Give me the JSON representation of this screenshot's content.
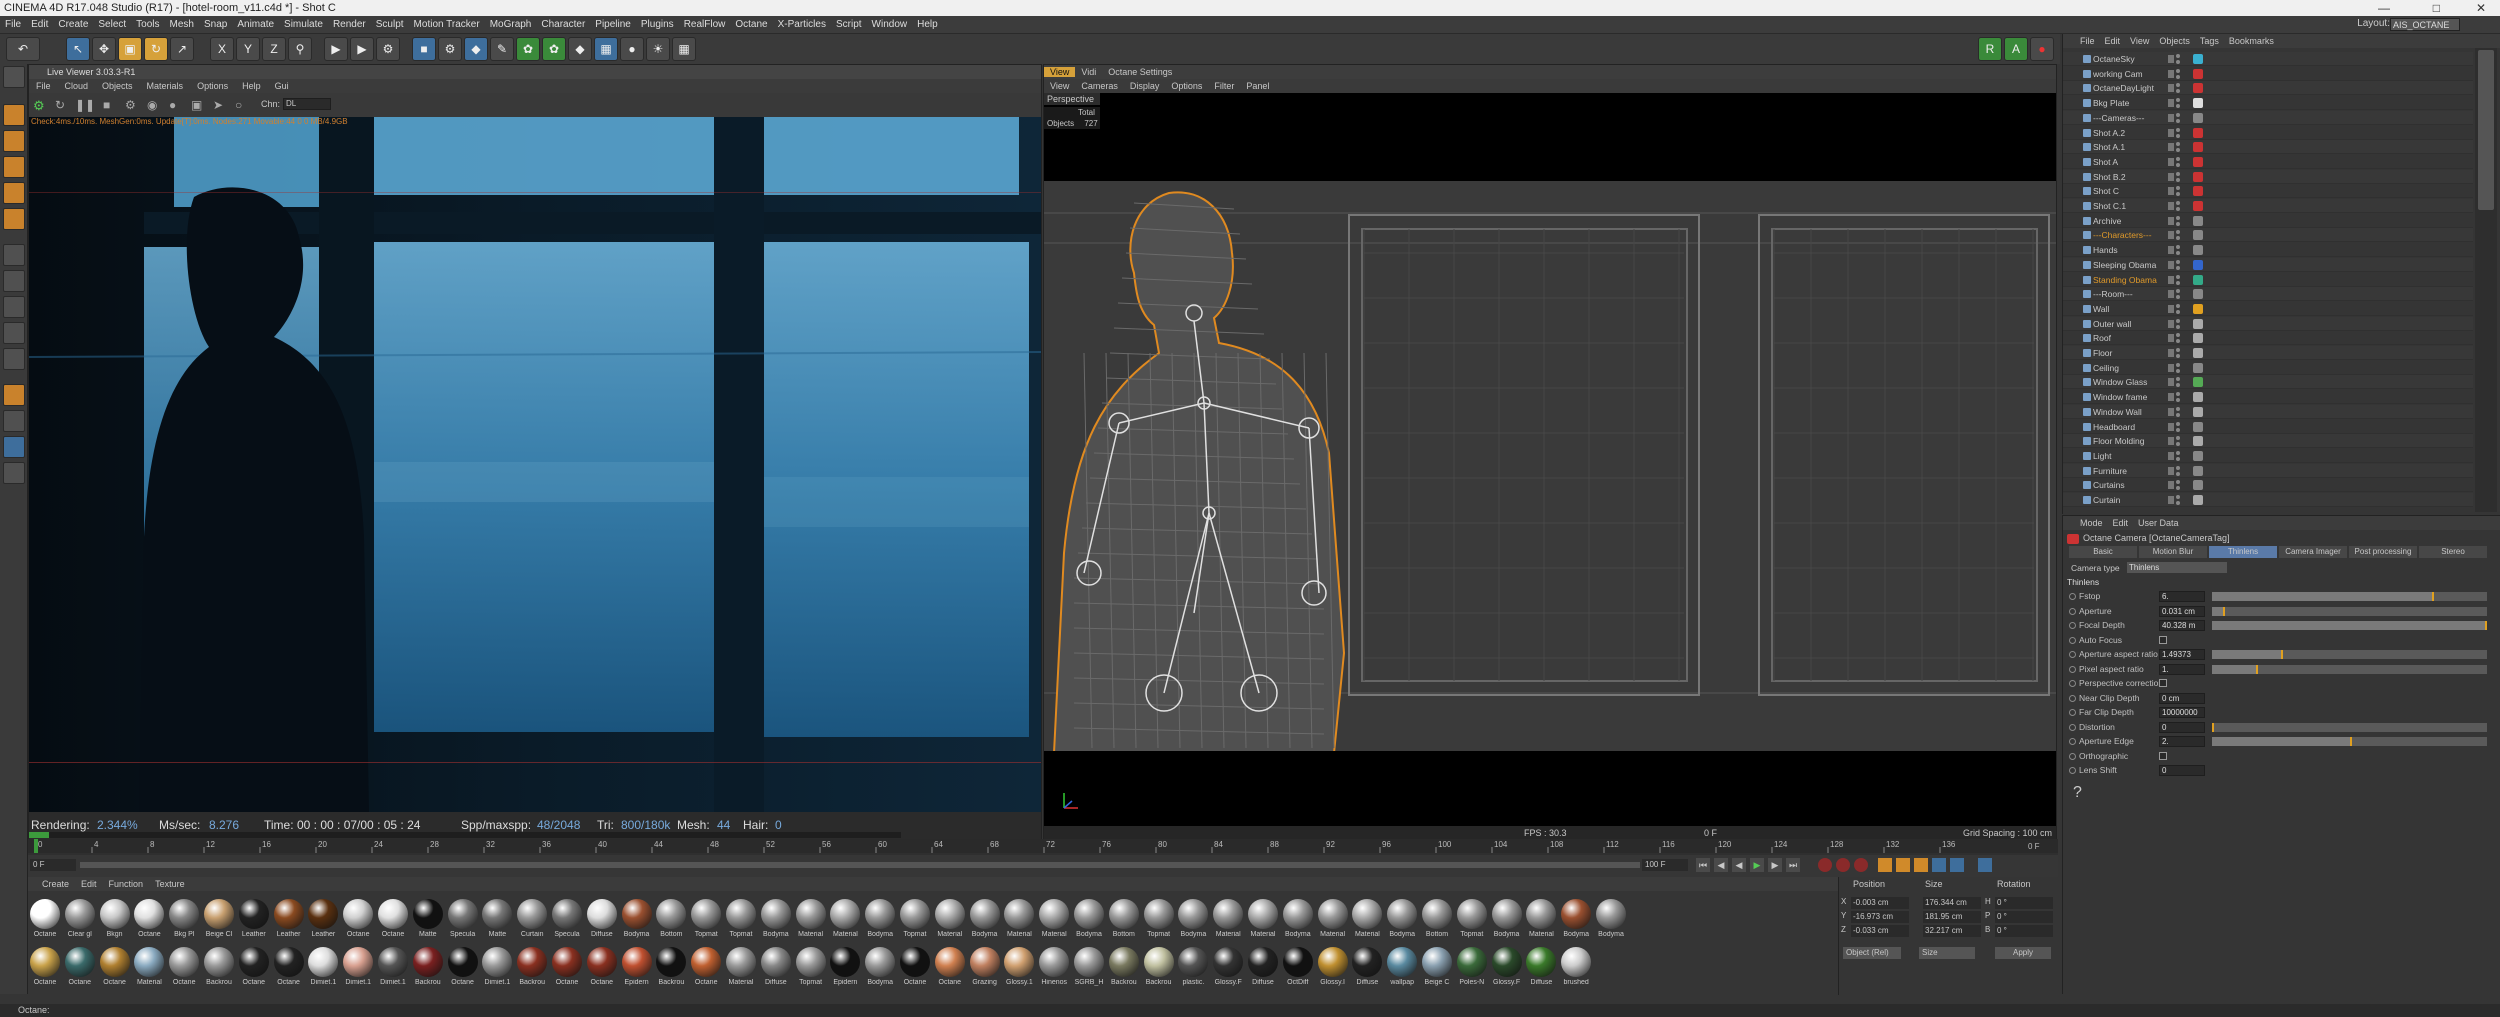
{
  "window": {
    "title": "CINEMA 4D R17.048 Studio (R17) - [hotel-room_v11.c4d *] - Shot C"
  },
  "menu": [
    "File",
    "Edit",
    "Create",
    "Select",
    "Tools",
    "Mesh",
    "Snap",
    "Animate",
    "Simulate",
    "Render",
    "Sculpt",
    "Motion Tracker",
    "MoGraph",
    "Character",
    "Pipeline",
    "Plugins",
    "RealFlow",
    "Octane",
    "X-Particles",
    "Script",
    "Window",
    "Help"
  ],
  "layout": {
    "label": "Layout:",
    "value": "AIS_OCTANE (User)"
  },
  "live_viewer": {
    "title": "Live Viewer 3.03.3-R1",
    "menu": [
      "File",
      "Cloud",
      "Objects",
      "Materials",
      "Options",
      "Help",
      "Gui"
    ],
    "chn_label": "Chn:",
    "chn_value": "DL",
    "status_line": "Check:4ms./10ms. MeshGen:0ms. Update[T]:0ms. Nodes:271 Movable:44   0 0 MB/4.9GB",
    "rendering_label": "Rendering:",
    "rendering_value": "2.344%",
    "mssec_label": "Ms/sec:",
    "mssec_value": "8.276",
    "time_label": "Time:",
    "time_value": "00 : 00 : 07/00 : 05 : 24",
    "spp_label": "Spp/maxspp:",
    "spp_value": "48/2048",
    "tri_label": "Tri:",
    "tri_value": "800/180k",
    "mesh_label": "Mesh:",
    "mesh_value": "44",
    "hair_label": "Hair:",
    "hair_value": "0"
  },
  "viewport": {
    "tabs": [
      "View",
      "Vidi",
      "Octane Settings"
    ],
    "menu": [
      "View",
      "Cameras",
      "Display",
      "Options",
      "Filter",
      "Panel"
    ],
    "camera_label": "Perspective",
    "stats_header": "Total",
    "stats_row_label": "Objects",
    "stats_row_value": "727",
    "fps": "FPS : 30.3",
    "frame": "0 F",
    "grid_spacing": "Grid Spacing : 100 cm"
  },
  "timeline": {
    "ticks": [
      "0",
      "4",
      "8",
      "12",
      "16",
      "20",
      "24",
      "28",
      "32",
      "36",
      "40",
      "44",
      "48",
      "52",
      "56",
      "60",
      "64",
      "68",
      "72",
      "76",
      "80",
      "84",
      "88",
      "92",
      "96",
      "100",
      "104",
      "108",
      "112",
      "116",
      "120",
      "124",
      "128",
      "132",
      "136"
    ],
    "end_label": "0 F",
    "start_field": "0 F",
    "min_field": "0 F",
    "max_field": "100 F",
    "end_field": "100 F"
  },
  "objects": {
    "menu": [
      "File",
      "Edit",
      "View",
      "Objects",
      "Tags",
      "Bookmarks"
    ],
    "rows": [
      {
        "name": "OctaneSky",
        "style": "n"
      },
      {
        "name": "working Cam",
        "style": "n"
      },
      {
        "name": "OctaneDayLight",
        "style": "n"
      },
      {
        "name": "Bkg Plate",
        "style": "n"
      },
      {
        "name": "---Cameras---",
        "style": "n"
      },
      {
        "name": "Shot A.2",
        "style": "n"
      },
      {
        "name": "Shot A.1",
        "style": "n"
      },
      {
        "name": "Shot A",
        "style": "n"
      },
      {
        "name": "Shot B.2",
        "style": "n"
      },
      {
        "name": "Shot C",
        "style": "n"
      },
      {
        "name": "Shot C.1",
        "style": "n"
      },
      {
        "name": "Archive",
        "style": "n"
      },
      {
        "name": "---Characters---",
        "style": "o"
      },
      {
        "name": "Hands",
        "style": "n"
      },
      {
        "name": "Sleeping Obama",
        "style": "n"
      },
      {
        "name": "Standing Obama",
        "style": "o"
      },
      {
        "name": "---Room---",
        "style": "n"
      },
      {
        "name": "Wall",
        "style": "n"
      },
      {
        "name": "Outer wall",
        "style": "n"
      },
      {
        "name": "Roof",
        "style": "n"
      },
      {
        "name": "Floor",
        "style": "n"
      },
      {
        "name": "Ceiling",
        "style": "n"
      },
      {
        "name": "Window Glass",
        "style": "n"
      },
      {
        "name": "Window frame",
        "style": "n"
      },
      {
        "name": "Window Wall",
        "style": "n"
      },
      {
        "name": "Headboard",
        "style": "n"
      },
      {
        "name": "Floor Molding",
        "style": "n"
      },
      {
        "name": "Light",
        "style": "n"
      },
      {
        "name": "Furniture",
        "style": "n"
      },
      {
        "name": "Curtains",
        "style": "n"
      },
      {
        "name": "Curtain",
        "style": "n"
      }
    ]
  },
  "attributes": {
    "menu": [
      "Mode",
      "Edit",
      "User Data"
    ],
    "object_title": "Octane Camera [OctaneCameraTag]",
    "tabs": [
      "Basic",
      "Motion Blur",
      "Thinlens",
      "Camera Imager",
      "Post processing",
      "Stereo"
    ],
    "active_tab": "Thinlens",
    "camera_type_label": "Camera type",
    "camera_type_value": "Thinlens",
    "section": "Thinlens",
    "fields": [
      {
        "label": "Fstop",
        "value": "6.",
        "fill": 0.8
      },
      {
        "label": "Aperture",
        "value": "0.031 cm",
        "fill": 0.04
      },
      {
        "label": "Focal Depth",
        "value": "40.328 m",
        "fill": 1.0
      },
      {
        "label": "Auto Focus",
        "value": "",
        "fill": -1
      },
      {
        "label": "Aperture aspect ratio",
        "value": "1.49373",
        "fill": 0.25
      },
      {
        "label": "Pixel aspect ratio",
        "value": "1.",
        "fill": 0.16
      },
      {
        "label": "Perspective correction",
        "value": "",
        "fill": -1
      },
      {
        "label": "Near Clip Depth",
        "value": "0 cm",
        "fill": -1
      },
      {
        "label": "Far Clip Depth",
        "value": "10000000",
        "fill": -1
      },
      {
        "label": "Distortion",
        "value": "0",
        "fill": 0.0
      },
      {
        "label": "Aperture Edge",
        "value": "2.",
        "fill": 0.5
      },
      {
        "label": "Orthographic",
        "value": "",
        "fill": -1
      },
      {
        "label": "Lens Shift",
        "value": "0",
        "fill": -1
      }
    ]
  },
  "materials": {
    "menu": [
      "Create",
      "Edit",
      "Function",
      "Texture"
    ],
    "row1": [
      {
        "label": "Octane",
        "color": "#ffffff"
      },
      {
        "label": "Clear gl",
        "color": "#9a9a9a"
      },
      {
        "label": "Bkgn",
        "color": "#c8c8c8"
      },
      {
        "label": "Octane",
        "color": "#e0e0e0"
      },
      {
        "label": "Bkg Pl",
        "color": "#888"
      },
      {
        "label": "Beige Cl",
        "color": "#c8a070"
      },
      {
        "label": "Leather",
        "color": "#222"
      },
      {
        "label": "Leather",
        "color": "#8a4a20"
      },
      {
        "label": "Leather",
        "color": "#5a3010"
      },
      {
        "label": "Octane",
        "color": "#d0d0d0"
      },
      {
        "label": "Octane",
        "color": "#e0e0e0"
      },
      {
        "label": "Matte",
        "color": "#111"
      },
      {
        "label": "Specula",
        "color": "#777"
      },
      {
        "label": "Matte",
        "color": "#777"
      },
      {
        "label": "Curtain",
        "color": "#999"
      },
      {
        "label": "Specula",
        "color": "#777"
      },
      {
        "label": "Diffuse",
        "color": "#ddd"
      },
      {
        "label": "Bodyma",
        "color": "#9a5030"
      },
      {
        "label": "Bottom",
        "color": "#999"
      },
      {
        "label": "Topmat",
        "color": "#999"
      },
      {
        "label": "Topmat",
        "color": "#999"
      },
      {
        "label": "Bodyma",
        "color": "#999"
      },
      {
        "label": "Material",
        "color": "#999"
      },
      {
        "label": "Material",
        "color": "#aaa"
      },
      {
        "label": "Bodyma",
        "color": "#999"
      },
      {
        "label": "Topmat",
        "color": "#999"
      },
      {
        "label": "Material",
        "color": "#aaa"
      },
      {
        "label": "Bodyma",
        "color": "#999"
      },
      {
        "label": "Material",
        "color": "#999"
      },
      {
        "label": "Material",
        "color": "#aaa"
      },
      {
        "label": "Bodyma",
        "color": "#999"
      },
      {
        "label": "Bottom",
        "color": "#999"
      },
      {
        "label": "Topmat",
        "color": "#999"
      },
      {
        "label": "Bodyma",
        "color": "#999"
      },
      {
        "label": "Material",
        "color": "#999"
      },
      {
        "label": "Material",
        "color": "#aaa"
      },
      {
        "label": "Bodyma",
        "color": "#999"
      },
      {
        "label": "Material",
        "color": "#999"
      },
      {
        "label": "Material",
        "color": "#aaa"
      },
      {
        "label": "Bodyma",
        "color": "#999"
      },
      {
        "label": "Bottom",
        "color": "#999"
      },
      {
        "label": "Topmat",
        "color": "#999"
      },
      {
        "label": "Bodyma",
        "color": "#999"
      },
      {
        "label": "Material",
        "color": "#999"
      },
      {
        "label": "Bodyma",
        "color": "#9a5030"
      },
      {
        "label": "Bodyma",
        "color": "#999"
      }
    ],
    "row2": [
      {
        "label": "Octane",
        "color": "#c9a24a"
      },
      {
        "label": "Octane",
        "color": "#3a6a6a"
      },
      {
        "label": "Octane",
        "color": "#b08030"
      },
      {
        "label": "Material",
        "color": "#8aaac0"
      },
      {
        "label": "Octane",
        "color": "#999"
      },
      {
        "label": "Backrou",
        "color": "#999"
      },
      {
        "label": "Octane",
        "color": "#222"
      },
      {
        "label": "Octane",
        "color": "#222"
      },
      {
        "label": "Dimiet.1",
        "color": "#ddd"
      },
      {
        "label": "Dimiet.1",
        "color": "#d8a090"
      },
      {
        "label": "Dimiet.1",
        "color": "#555"
      },
      {
        "label": "Backrou",
        "color": "#7a2020"
      },
      {
        "label": "Octane",
        "color": "#111"
      },
      {
        "label": "Dimiet.1",
        "color": "#999"
      },
      {
        "label": "Backrou",
        "color": "#8a3020"
      },
      {
        "label": "Octane",
        "color": "#8a3020"
      },
      {
        "label": "Octane",
        "color": "#8a3020"
      },
      {
        "label": "Epidern",
        "color": "#c05030"
      },
      {
        "label": "Backrou",
        "color": "#111"
      },
      {
        "label": "Octane",
        "color": "#c06030"
      },
      {
        "label": "Material",
        "color": "#999"
      },
      {
        "label": "Diffuse",
        "color": "#888"
      },
      {
        "label": "Topmat",
        "color": "#999"
      },
      {
        "label": "Epidern",
        "color": "#111"
      },
      {
        "label": "Bodyma",
        "color": "#999"
      },
      {
        "label": "Octane",
        "color": "#111"
      },
      {
        "label": "Octane",
        "color": "#d08050"
      },
      {
        "label": "Grazing",
        "color": "#c08060"
      },
      {
        "label": "Glossy.1",
        "color": "#d0a070"
      },
      {
        "label": "Hinenos",
        "color": "#999"
      },
      {
        "label": "SGRB_H",
        "color": "#999"
      },
      {
        "label": "Backrou",
        "color": "#7a7a60"
      },
      {
        "label": "Backrou",
        "color": "#c0c0a0"
      },
      {
        "label": "plastic.",
        "color": "#555"
      },
      {
        "label": "Glossy.F",
        "color": "#333"
      },
      {
        "label": "Diffuse",
        "color": "#222"
      },
      {
        "label": "OctDiff",
        "color": "#111"
      },
      {
        "label": "Glossy.I",
        "color": "#c09030"
      },
      {
        "label": "Diffuse",
        "color": "#222"
      },
      {
        "label": "wallpap",
        "color": "#5a8aa0"
      },
      {
        "label": "Beige C",
        "color": "#8aa0b0"
      },
      {
        "label": "Poles-N",
        "color": "#3a6a3a"
      },
      {
        "label": "Glossy.F",
        "color": "#2a4a2a"
      },
      {
        "label": "Diffuse",
        "color": "#3a7a2a"
      },
      {
        "label": "brushed",
        "color": "#ccc"
      }
    ]
  },
  "coords": {
    "headers": [
      "Position",
      "Size",
      "Rotation"
    ],
    "rows": [
      {
        "axis": "X",
        "pos": "-0.003 cm",
        "size": "176.344 cm",
        "rot_axis": "H",
        "rot": "0 °"
      },
      {
        "axis": "Y",
        "pos": "-16.973 cm",
        "size": "181.95 cm",
        "rot_axis": "P",
        "rot": "0 °"
      },
      {
        "axis": "Z",
        "pos": "-0.033 cm",
        "size": "32.217 cm",
        "rot_axis": "B",
        "rot": "0 °"
      }
    ],
    "mode1": "Object (Rel)",
    "mode2": "Size",
    "apply": "Apply"
  },
  "statusbar": "Octane:"
}
